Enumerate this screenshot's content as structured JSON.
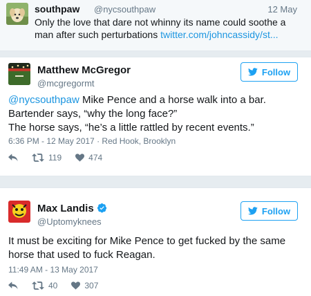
{
  "reply_tweet": {
    "name": "southpaw",
    "handle": "@nycsouthpaw",
    "date": "12 May",
    "text": "Only the love that dare not whinny its name could soothe a man after such perturbations",
    "link": "twitter.com/johncassidy/st..."
  },
  "tweets": [
    {
      "name": "Matthew McGregor",
      "handle": "@mcgregormt",
      "follow_label": "Follow",
      "mention": "@nycsouthpaw",
      "line1": " Mike Pence and a horse walk into a bar.",
      "line2": "Bartender says, “why the long face?”",
      "line3": "The horse says, “he’s a little rattled by recent events.”",
      "timestamp": "6:36 PM - 12 May 2017 · Red Hook, Brooklyn",
      "retweets": "119",
      "likes": "474"
    },
    {
      "name": "Max Landis",
      "handle": "@Uptomyknees",
      "follow_label": "Follow",
      "verified": true,
      "text": "It must be exciting for Mike Pence to get fucked by the same horse that used to fuck Reagan.",
      "timestamp": "11:49 AM - 13 May 2017",
      "retweets": "40",
      "likes": "307"
    }
  ],
  "colors": {
    "twitter_blue": "#1da1f2",
    "link_blue": "#1b95e0",
    "muted_gray": "#657786",
    "verified_blue": "#1da1f2"
  },
  "icons": [
    "reply-icon",
    "retweet-icon",
    "heart-icon",
    "twitter-bird-icon",
    "verified-badge-icon"
  ]
}
